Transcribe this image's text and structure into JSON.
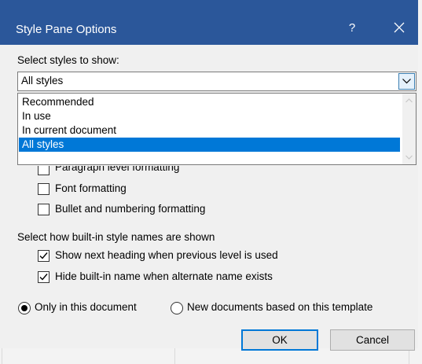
{
  "dialog": {
    "title": "Style Pane Options",
    "help_glyph": "?",
    "select_styles_label": "Select styles to show:",
    "combo_value": "All styles",
    "list_options": [
      "Recommended",
      "In use",
      "In current document",
      "All styles"
    ],
    "selected_option": "All styles",
    "formatting_options": [
      {
        "label": "Paragraph level formatting",
        "checked": false
      },
      {
        "label": "Font formatting",
        "checked": false
      },
      {
        "label": "Bullet and numbering formatting",
        "checked": false
      }
    ],
    "builtin_names_heading": "Select how built-in style names are shown",
    "builtin_options": [
      {
        "label": "Show next heading when previous level is used",
        "checked": true
      },
      {
        "label": "Hide built-in name when alternate name exists",
        "checked": true
      }
    ],
    "scope_options": [
      {
        "label": "Only in this document",
        "selected": true
      },
      {
        "label": "New documents based on this template",
        "selected": false
      }
    ],
    "ok_label": "OK",
    "cancel_label": "Cancel"
  },
  "colors": {
    "titlebar": "#2b579a",
    "selection": "#0078d7",
    "dialog_bg": "#f0f0f0"
  },
  "icons": [
    "close-icon",
    "dropdown-arrow-icon",
    "scroll-up-icon",
    "scroll-down-icon",
    "checkmark-icon"
  ]
}
